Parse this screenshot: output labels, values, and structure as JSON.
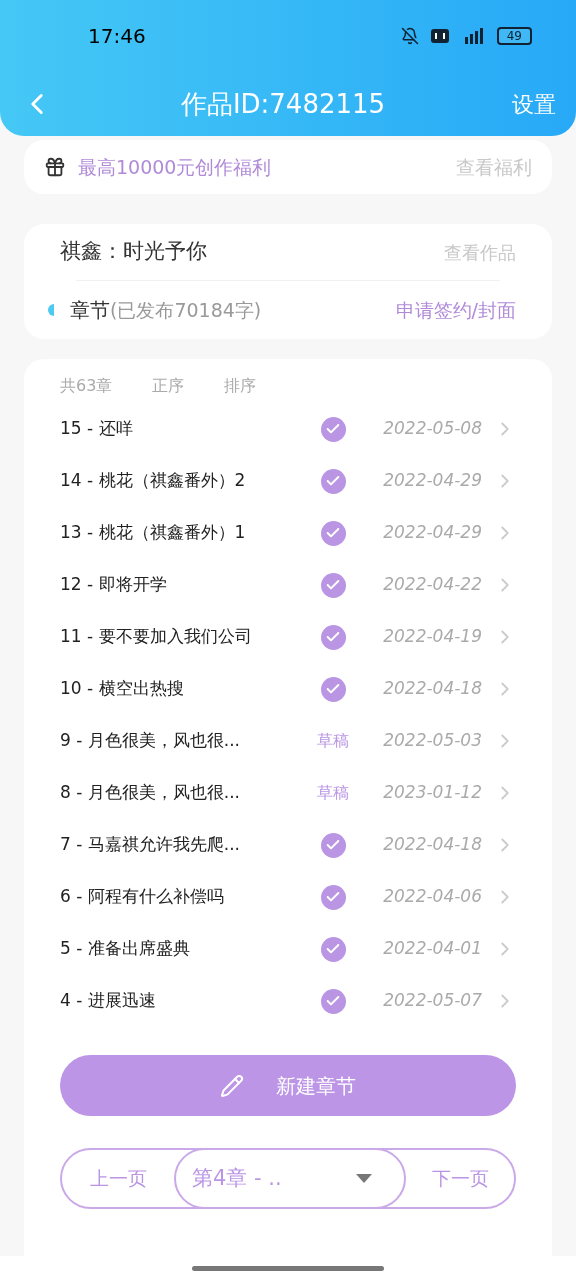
{
  "status_bar": {
    "time": "17:46",
    "battery": "49"
  },
  "header": {
    "title": "作品ID:7482115",
    "settings": "设置"
  },
  "welfare": {
    "text": "最高10000元创作福利",
    "link": "查看福利"
  },
  "work": {
    "name": "祺鑫：时光予你",
    "link": "查看作品",
    "chapters_label": "章节",
    "chapters_info": "(已发布70184字)",
    "apply": "申请签约/封面"
  },
  "list_header": {
    "count": "共63章",
    "order": "正序",
    "sort": "排序"
  },
  "chapters": [
    {
      "title": "15 - 还咩",
      "published": true,
      "date": "2022-05-08"
    },
    {
      "title": "14 - 桃花（祺鑫番外）2",
      "published": true,
      "date": "2022-04-29"
    },
    {
      "title": "13 - 桃花（祺鑫番外）1",
      "published": true,
      "date": "2022-04-29"
    },
    {
      "title": "12 - 即将开学",
      "published": true,
      "date": "2022-04-22"
    },
    {
      "title": "11 - 要不要加入我们公司",
      "published": true,
      "date": "2022-04-19"
    },
    {
      "title": "10 - 横空出热搜",
      "published": true,
      "date": "2022-04-18"
    },
    {
      "title": "9 - 月色很美，风也很...",
      "published": false,
      "badge": "草稿",
      "date": "2022-05-03"
    },
    {
      "title": "8 - 月色很美，风也很...",
      "published": false,
      "badge": "草稿",
      "date": "2023-01-12"
    },
    {
      "title": "7 - 马嘉祺允许我先爬...",
      "published": true,
      "date": "2022-04-18"
    },
    {
      "title": "6 - 阿程有什么补偿吗",
      "published": true,
      "date": "2022-04-06"
    },
    {
      "title": "5 - 准备出席盛典",
      "published": true,
      "date": "2022-04-01"
    },
    {
      "title": "4 - 进展迅速",
      "published": true,
      "date": "2022-05-07"
    }
  ],
  "new_chapter": "新建章节",
  "pager": {
    "prev": "上一页",
    "current": "第4章 - ..",
    "next": "下一页"
  }
}
